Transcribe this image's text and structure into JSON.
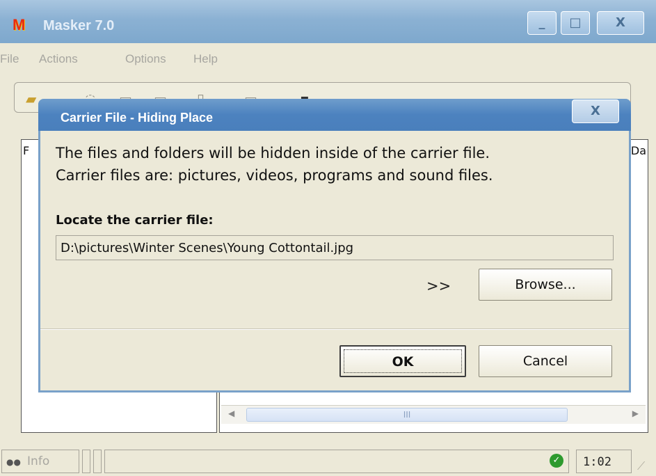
{
  "app": {
    "title": "Masker 7.0",
    "icon_glyph": "M",
    "caption": {
      "minimize": "_",
      "maximize": "□",
      "close": "X"
    }
  },
  "menu": {
    "items": [
      "File",
      "Actions",
      "Options",
      "Help"
    ]
  },
  "panels": {
    "left_header": "F",
    "right_header": "Da",
    "scroll_thumb_grip": "III"
  },
  "dialog": {
    "title": "Carrier File - Hiding Place",
    "close_glyph": "X",
    "description_line1": "The files and folders will be hidden inside of the carrier file.",
    "description_line2": "Carrier files are: pictures, videos, programs and sound files.",
    "locate_label": "Locate the carrier file:",
    "carrier_path": "D:\\pictures\\Winter Scenes\\Young Cottontail.jpg",
    "arrows": ">>",
    "browse_label": "Browse...",
    "ok_label": "OK",
    "cancel_label": "Cancel"
  },
  "status": {
    "info_label": "Info",
    "time": "1:02",
    "status_icon": "check-icon"
  },
  "colors": {
    "window_bg": "#ece9d8",
    "dialog_title_bg": "#4a7fbc",
    "inactive_title_bg": "#8bb1d3",
    "status_ok": "#2e9a2e"
  }
}
